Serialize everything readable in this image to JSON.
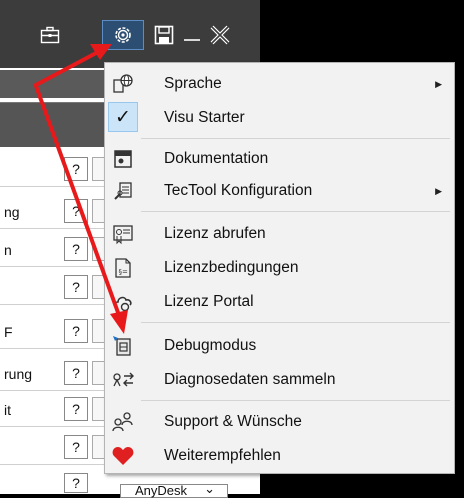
{
  "titlebar": {
    "icons": [
      "briefcase-icon",
      "gear-icon",
      "save-icon",
      "minimize-icon",
      "close-icon"
    ]
  },
  "background_rows": [
    {
      "label": "",
      "q": "?"
    },
    {
      "label": "ng",
      "q": "?"
    },
    {
      "label": "n",
      "q": "?"
    },
    {
      "label": "",
      "q": "?"
    },
    {
      "label": "F",
      "q": "?"
    },
    {
      "label": "rung",
      "q": "?"
    },
    {
      "label": "it",
      "q": "?"
    },
    {
      "label": "",
      "q": "?"
    },
    {
      "label": "",
      "q": "?"
    }
  ],
  "bottom_select": {
    "value": "AnyDesk",
    "arrow": "⌄"
  },
  "menu": {
    "items": [
      {
        "label": "Sprache",
        "icon": "language-globe-icon",
        "submenu": true
      },
      {
        "label": "Visu Starter",
        "icon": "checkmark-icon",
        "checked": true
      },
      {
        "label": "Dokumentation",
        "icon": "documentation-icon"
      },
      {
        "label": "TecTool Konfiguration",
        "icon": "config-tool-icon",
        "submenu": true
      },
      {
        "label": "Lizenz abrufen",
        "icon": "license-fetch-icon"
      },
      {
        "label": "Lizenzbedingungen",
        "icon": "license-terms-icon"
      },
      {
        "label": "Lizenz Portal",
        "icon": "cloud-portal-icon"
      },
      {
        "label": "Debugmodus",
        "icon": "debug-icon"
      },
      {
        "label": "Diagnosedaten sammeln",
        "icon": "diagnose-icon"
      },
      {
        "label": "Support & Wünsche",
        "icon": "support-users-icon"
      },
      {
        "label": "Weiterempfehlen",
        "icon": "heart-icon"
      }
    ],
    "submenu_arrow": "▶",
    "check_glyph": "✓"
  },
  "colors": {
    "accent_arrow": "#e8191a",
    "titlebar_bg": "#3c3c3c",
    "gear_highlight": "#2c4e72",
    "heart": "#e02020",
    "checked_bg": "#cce4f7"
  }
}
